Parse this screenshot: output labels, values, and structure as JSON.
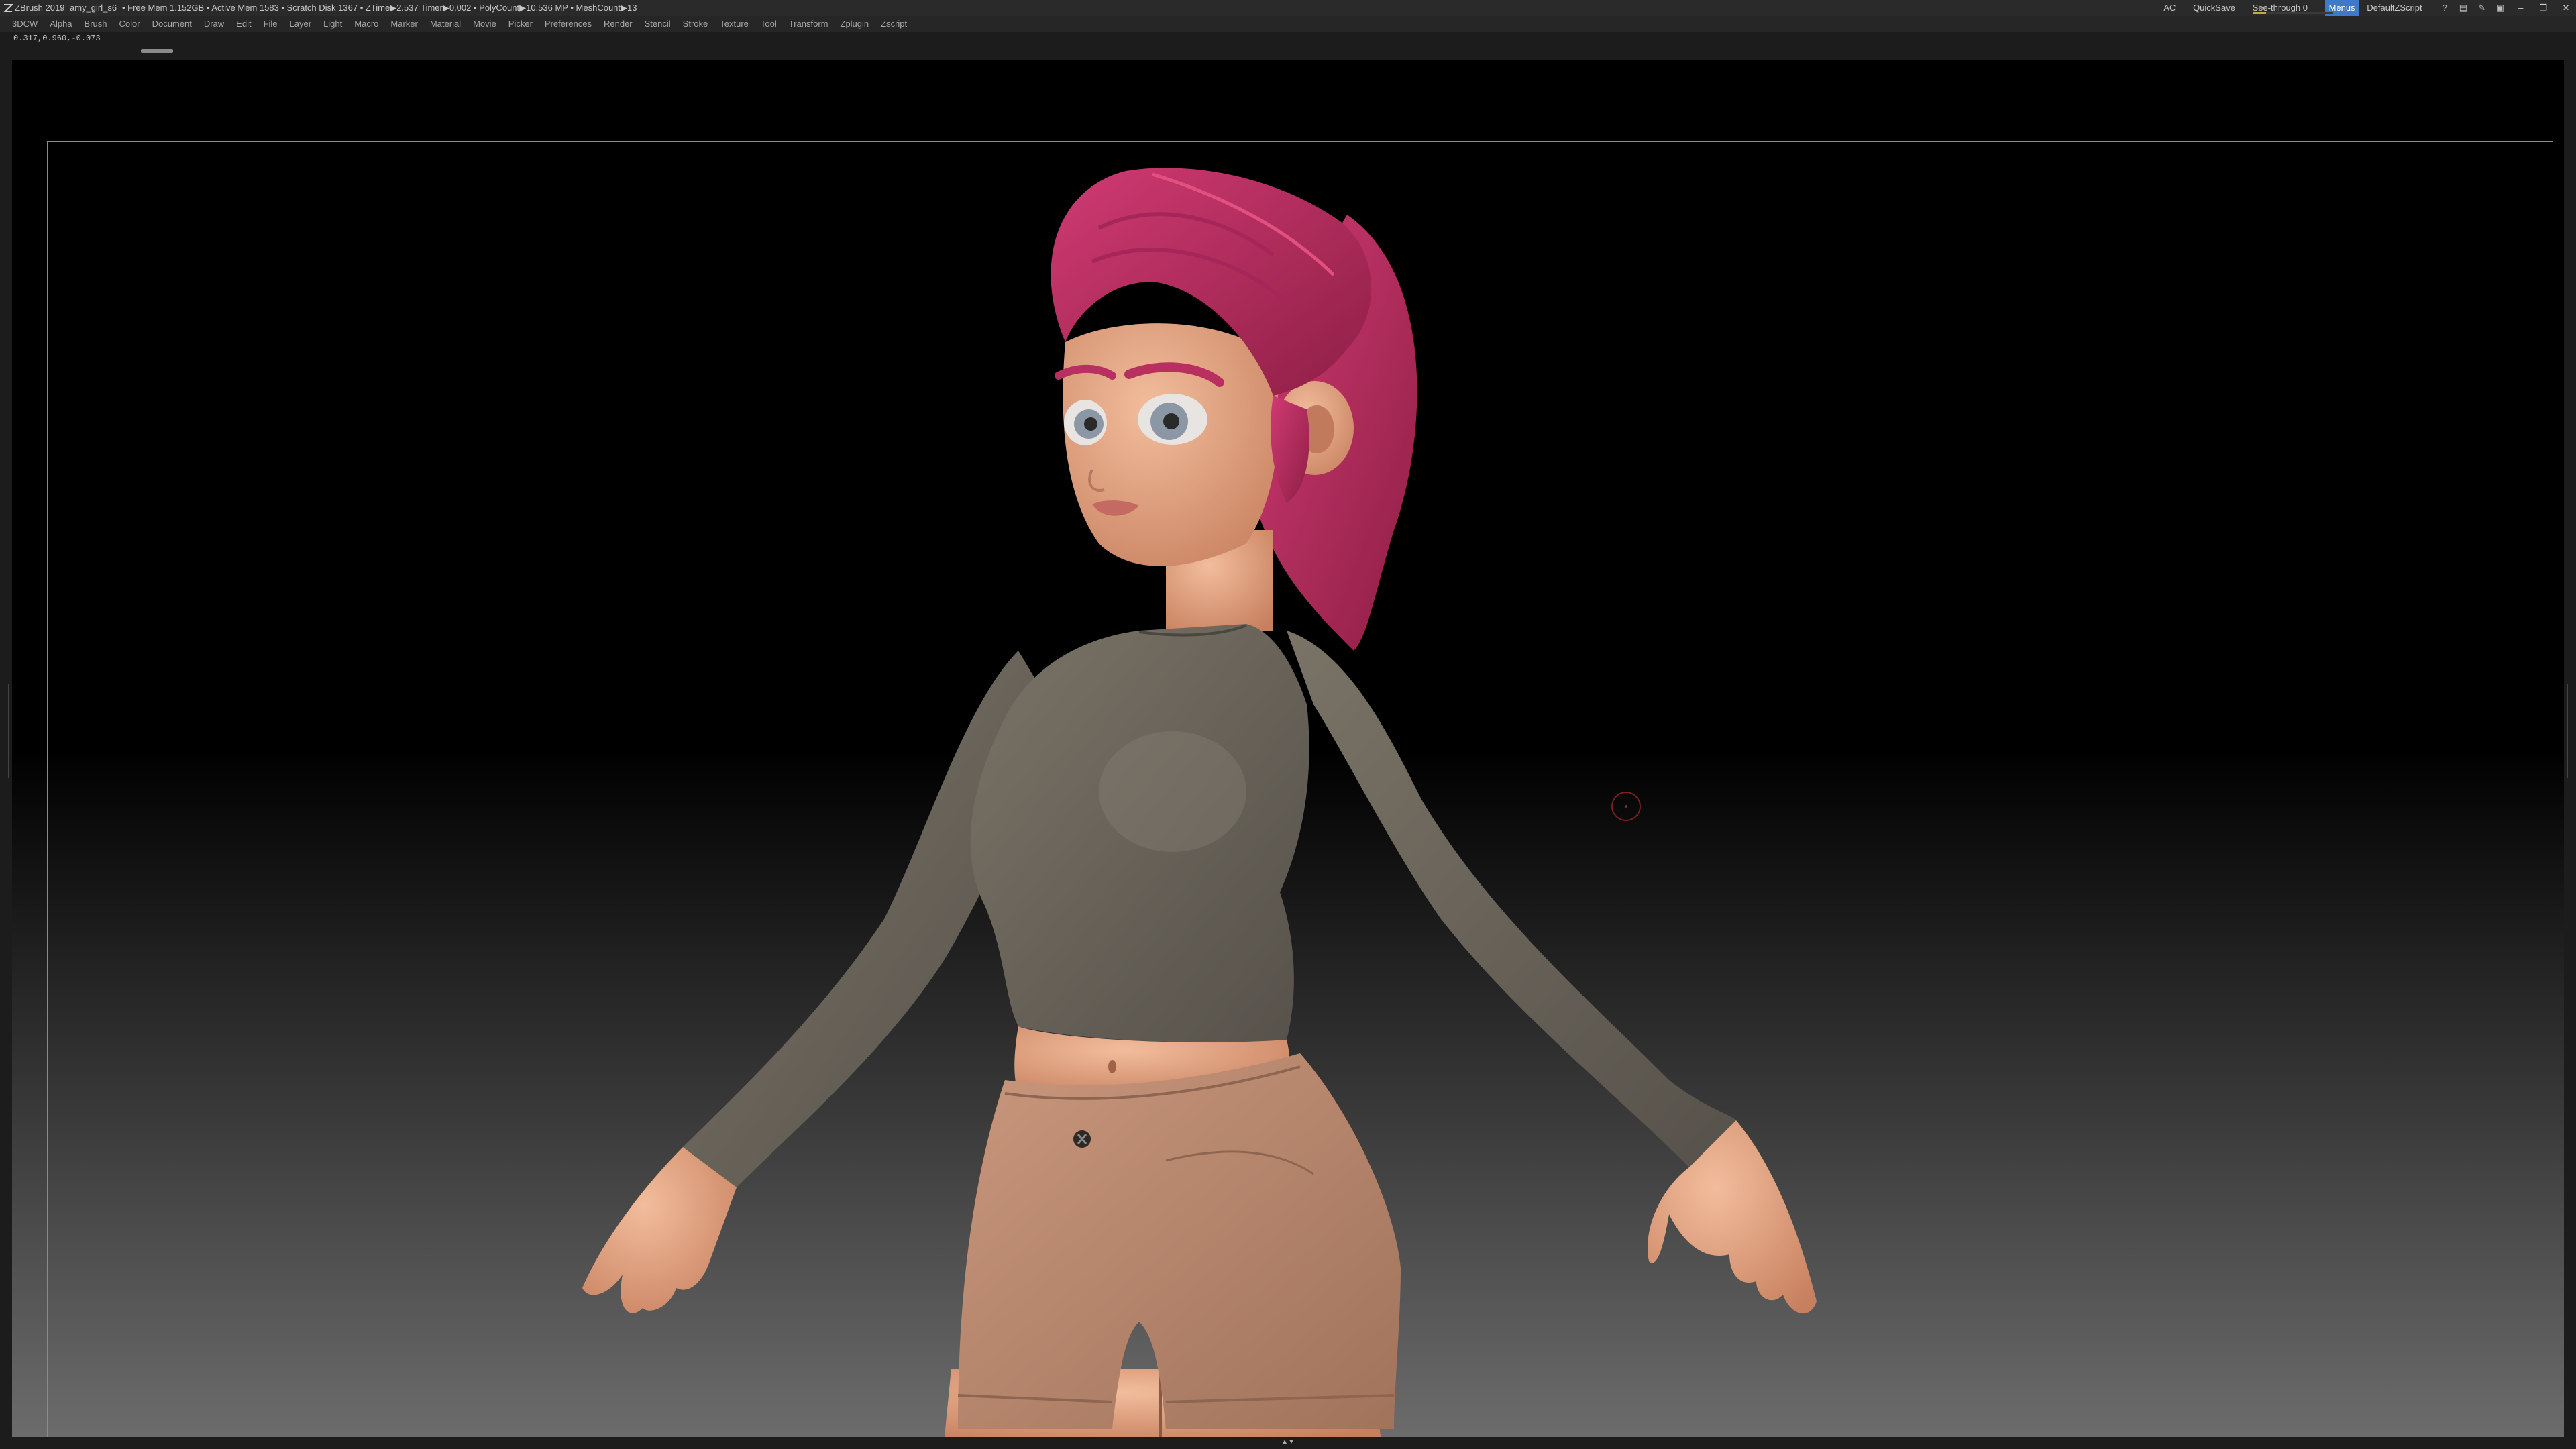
{
  "titlebar": {
    "app_title": "ZBrush 2019",
    "document_name": "amy_girl_s6",
    "status_text": "• Free Mem 1.152GB • Active Mem 1583 • Scratch Disk 1367 • ZTime▶2.537 Timer▶0.002 • PolyCount▶10.536 MP • MeshCount▶13",
    "ac": "AC",
    "quicksave": "QuickSave",
    "see_through": "See-through 0",
    "see_through_value": 0,
    "menus_label": "Menus",
    "default_script": "DefaultZScript",
    "accent_color": "#3f7ac9",
    "window_buttons": [
      "minimize",
      "restore",
      "close"
    ]
  },
  "menubar": {
    "items": [
      "3DCW",
      "Alpha",
      "Brush",
      "Color",
      "Document",
      "Draw",
      "Edit",
      "File",
      "Layer",
      "Light",
      "Macro",
      "Marker",
      "Material",
      "Movie",
      "Picker",
      "Preferences",
      "Render",
      "Stencil",
      "Stroke",
      "Texture",
      "Tool",
      "Transform",
      "Zplugin",
      "Zscript"
    ]
  },
  "coords": "0.317,0.960,-0.073",
  "model": {
    "hair_color": "#b8305f",
    "shirt_color": "#6c6659",
    "shorts_color": "#b8876e",
    "skin_color": "#e3a886"
  },
  "icons": [
    "zbrush-logo-icon",
    "help-icon",
    "layout-icon",
    "brush-icon",
    "lock-icon"
  ]
}
